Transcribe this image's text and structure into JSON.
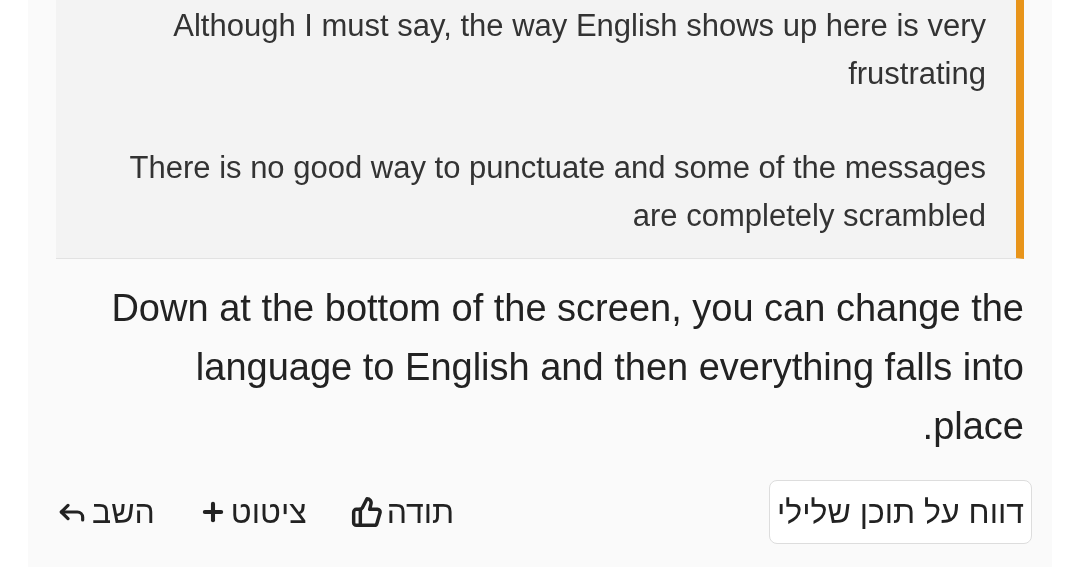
{
  "quote": {
    "paragraphs": [
      "Although I must say, the way English shows up here is very frustrating",
      "There is no good way to punctuate and some of the messages are completely scrambled"
    ]
  },
  "post": {
    "text": "Down at the bottom of the screen, you can change the language to English and then everything falls into place."
  },
  "actions": [
    {
      "kind": "report",
      "label": "דווח על תוכן שלילי"
    },
    {
      "kind": "like",
      "label": "תודה"
    },
    {
      "kind": "quote",
      "label": "ציטוט"
    },
    {
      "kind": "reply",
      "label": "השב"
    }
  ]
}
